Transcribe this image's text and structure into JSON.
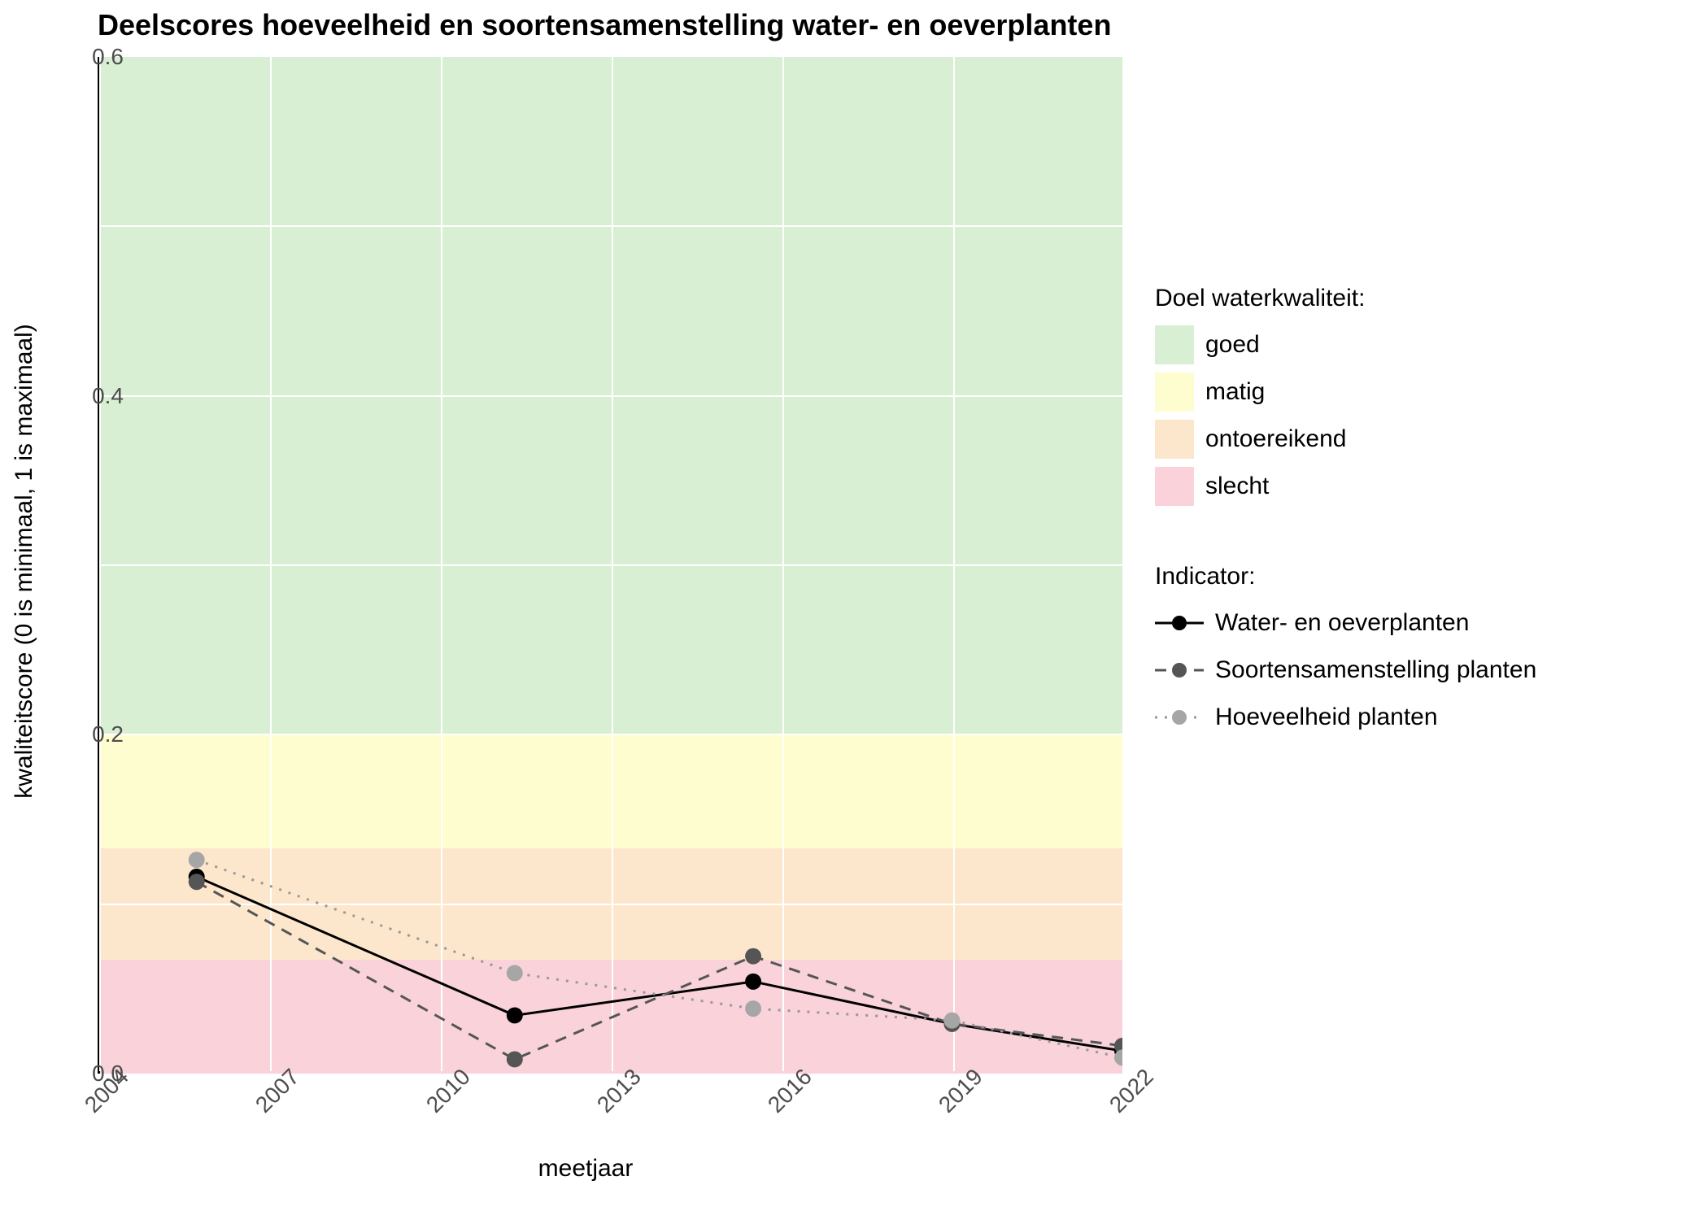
{
  "chart_data": {
    "type": "line",
    "title": "Deelscores hoeveelheid en soortensamenstelling water- en oeverplanten",
    "xlabel": "meetjaar",
    "ylabel": "kwaliteitscore (0 is minimaal, 1 is maximaal)",
    "ylim": [
      0,
      0.6
    ],
    "xlim": [
      2004,
      2022
    ],
    "x": [
      2005.7,
      2011.3,
      2015.5,
      2019,
      2022
    ],
    "x_ticks": [
      2004,
      2007,
      2010,
      2013,
      2016,
      2019,
      2022
    ],
    "y_ticks": [
      0.0,
      0.2,
      0.4,
      0.6
    ],
    "series": [
      {
        "name": "Water- en oeverplanten",
        "color": "#000000",
        "dash": "solid",
        "marker_fill": "#000000",
        "values": [
          0.115,
          0.033,
          0.053,
          0.028,
          0.012
        ]
      },
      {
        "name": "Soortensamenstelling planten",
        "color": "#555555",
        "dash": "dashed",
        "marker_fill": "#555555",
        "values": [
          0.112,
          0.007,
          0.068,
          0.028,
          0.015
        ]
      },
      {
        "name": "Hoeveelheid planten",
        "color": "#999999",
        "dash": "dotted",
        "marker_fill": "#a6a6a6",
        "values": [
          0.125,
          0.058,
          0.037,
          0.03,
          0.008
        ]
      }
    ],
    "bands": [
      {
        "label": "goed",
        "color": "#d9efd3",
        "ymin": 0.2,
        "ymax": 0.6
      },
      {
        "label": "matig",
        "color": "#fdfdd0",
        "ymin": 0.133,
        "ymax": 0.2
      },
      {
        "label": "ontoereikend",
        "color": "#fde7cc",
        "ymin": 0.067,
        "ymax": 0.133
      },
      {
        "label": "slecht",
        "color": "#f9d2da",
        "ymin": 0.0,
        "ymax": 0.067
      }
    ],
    "legend_bands_title": "Doel waterkwaliteit:",
    "legend_series_title": "Indicator:"
  }
}
